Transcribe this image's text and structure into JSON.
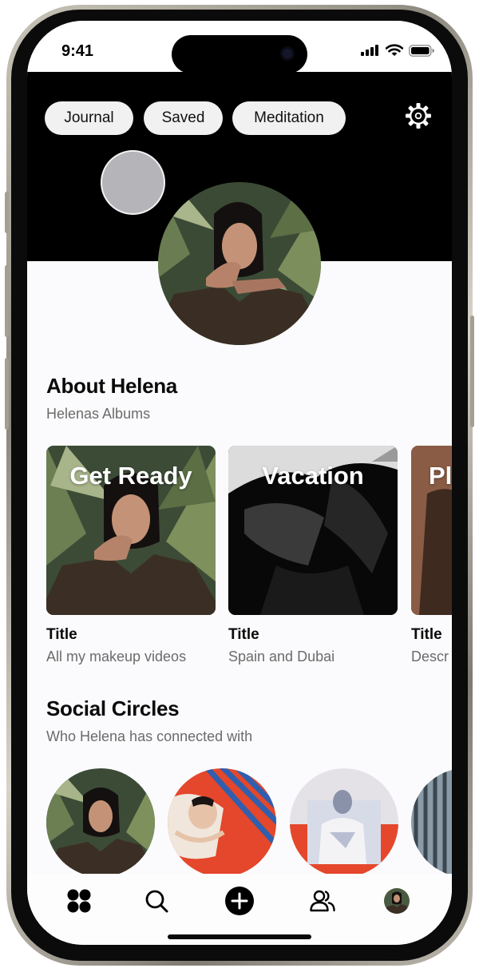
{
  "status_bar": {
    "time": "9:41"
  },
  "header": {
    "tabs": [
      {
        "label": "Journal"
      },
      {
        "label": "Saved"
      },
      {
        "label": "Meditation"
      }
    ],
    "settings_icon": "gear-icon"
  },
  "profile": {
    "name": "Helena"
  },
  "about": {
    "title": "About Helena",
    "subtitle": "Helenas Albums"
  },
  "albums": [
    {
      "label": "Get Ready",
      "title": "Title",
      "description": "All my makeup videos"
    },
    {
      "label": "Vacation",
      "title": "Title",
      "description": "Spain and Dubai"
    },
    {
      "label": "Pla",
      "title": "Title",
      "description": "Descr"
    }
  ],
  "social": {
    "title": "Social Circles",
    "subtitle": "Who Helena has connected with",
    "circle_count": 4
  },
  "bottom_nav": {
    "items": [
      "apps-icon",
      "search-icon",
      "add-icon",
      "people-icon",
      "profile-avatar"
    ]
  },
  "colors": {
    "header_bg": "#000000",
    "pill_bg": "#f1f1f1",
    "text_primary": "#0a0a0a",
    "text_secondary": "#6b6b6b",
    "accent_orange": "#e4472b",
    "frame_titanium": "#a39f95"
  }
}
